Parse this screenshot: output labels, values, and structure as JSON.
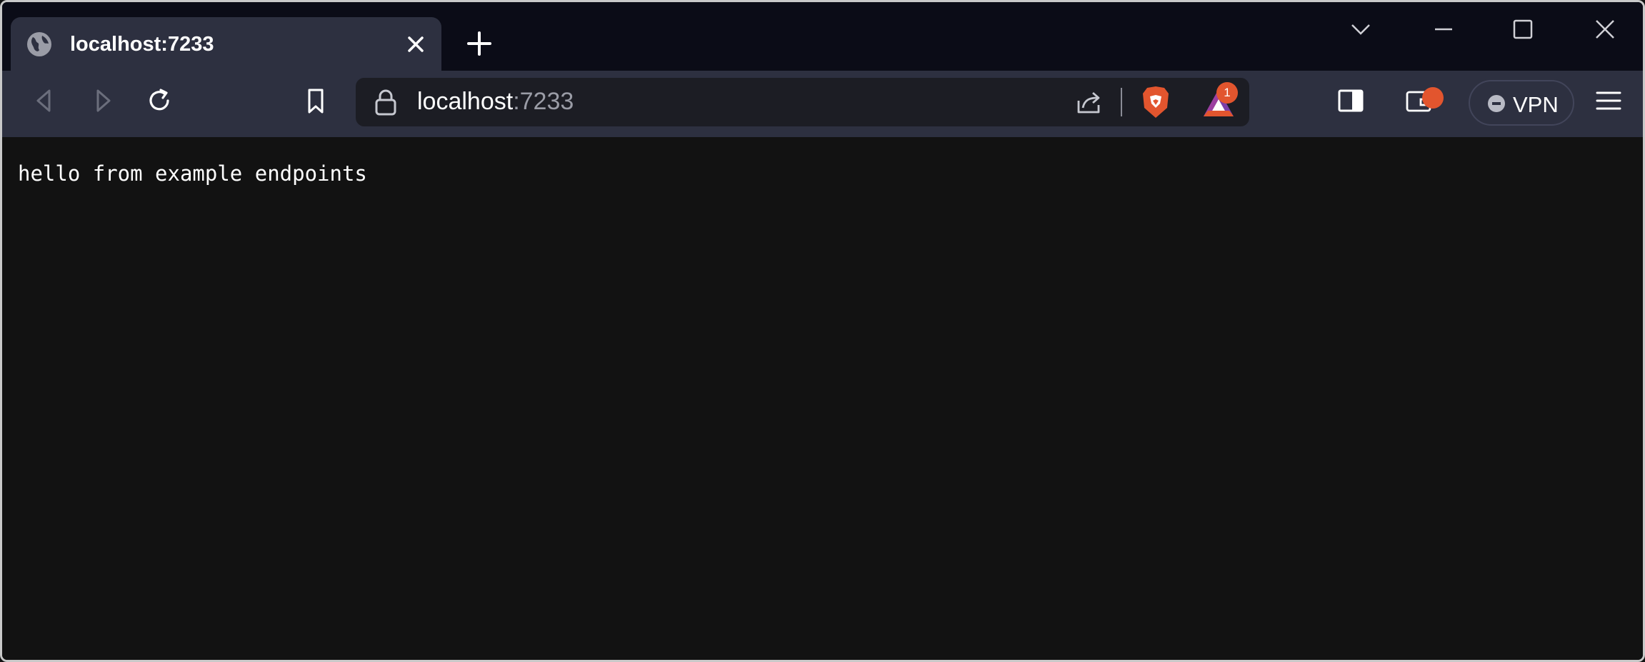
{
  "tab": {
    "title": "localhost:7233"
  },
  "address": {
    "host": "localhost",
    "port": ":7233"
  },
  "wallet": {
    "badge_count": "1"
  },
  "vpn": {
    "label": "VPN"
  },
  "page": {
    "text": "hello from example endpoints"
  },
  "colors": {
    "accent": "#e2552e",
    "toolbar": "#2d3040",
    "tabstrip": "#0b0c17",
    "content_bg": "#121212"
  }
}
